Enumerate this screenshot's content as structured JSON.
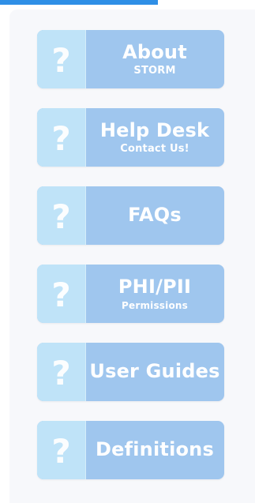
{
  "menu": {
    "items": [
      {
        "title": "About",
        "subtitle": "STORM"
      },
      {
        "title": "Help Desk",
        "subtitle": "Contact Us!"
      },
      {
        "title": "FAQs",
        "subtitle": ""
      },
      {
        "title": "PHI/PII",
        "subtitle": "Permissions"
      },
      {
        "title": "User Guides",
        "subtitle": ""
      },
      {
        "title": "Definitions",
        "subtitle": ""
      }
    ],
    "icon_glyph": "?",
    "icon_name": "question-mark-icon"
  },
  "colors": {
    "top_accent": "#2f8fe6",
    "panel_bg": "#f7f8fb",
    "button_bg": "#9fc6ee",
    "icon_bg": "#bfe3f8",
    "text": "#ffffff"
  }
}
